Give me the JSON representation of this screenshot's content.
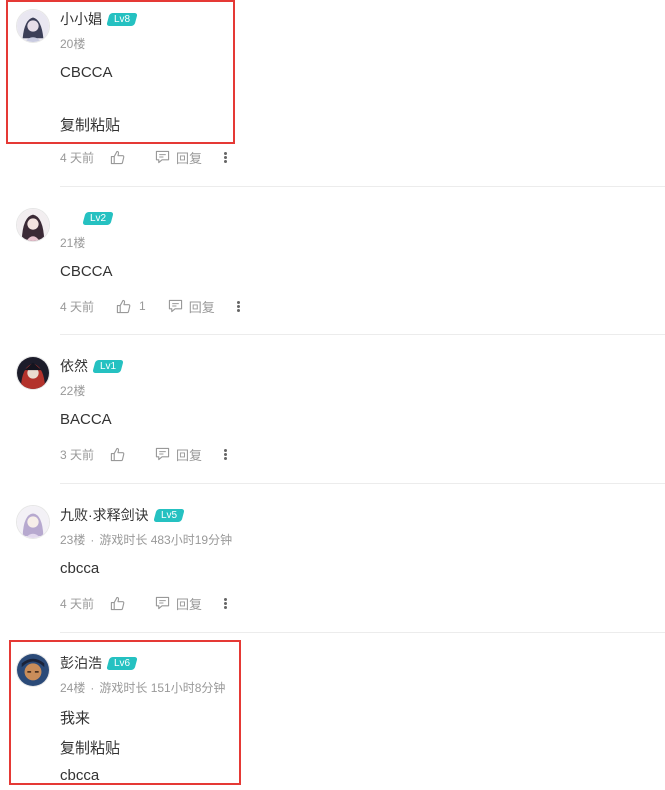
{
  "comments": [
    {
      "username": "小小娼",
      "level": "Lv8",
      "floor": "20楼",
      "content": [
        "CBCCA",
        "复制粘贴"
      ],
      "time": "4 天前",
      "likes": "",
      "reply_label": "回复",
      "avatar_colors": [
        "#e9e7f1",
        "#3c3f58",
        "#c9cbe0"
      ]
    },
    {
      "username": "",
      "level": "Lv2",
      "floor": "21楼",
      "content": [
        "CBCCA"
      ],
      "time": "4 天前",
      "likes": "1",
      "reply_label": "回复",
      "avatar_colors": [
        "#f2eef0",
        "#3b2a36",
        "#e8c3cf"
      ]
    },
    {
      "username": "依然",
      "level": "Lv1",
      "floor": "22楼",
      "content": [
        "BACCA"
      ],
      "time": "3 天前",
      "likes": "",
      "reply_label": "回复",
      "avatar_colors": [
        "#1c1c2a",
        "#b3322c",
        "#eadbd0"
      ]
    },
    {
      "username": "九败·求释剑诀",
      "level": "Lv5",
      "floor": "23楼",
      "playtime": "游戏时长 483小时19分钟",
      "content": [
        "cbcca"
      ],
      "time": "4 天前",
      "likes": "",
      "reply_label": "回复",
      "avatar_colors": [
        "#f3f1f6",
        "#b7a9cf",
        "#e3d9ee"
      ]
    },
    {
      "username": "彭泊浩",
      "level": "Lv6",
      "floor": "24楼",
      "playtime": "游戏时长 151小时8分钟",
      "content": [
        "我来",
        "复制粘贴",
        "cbcca"
      ],
      "avatar_colors": [
        "#2b4a78",
        "#c98d5a",
        "#1a2238"
      ]
    }
  ],
  "separator": "·",
  "colors": {
    "level_badge": "#25c1c1",
    "highlight": "#e53935",
    "meta_text": "#999999"
  }
}
